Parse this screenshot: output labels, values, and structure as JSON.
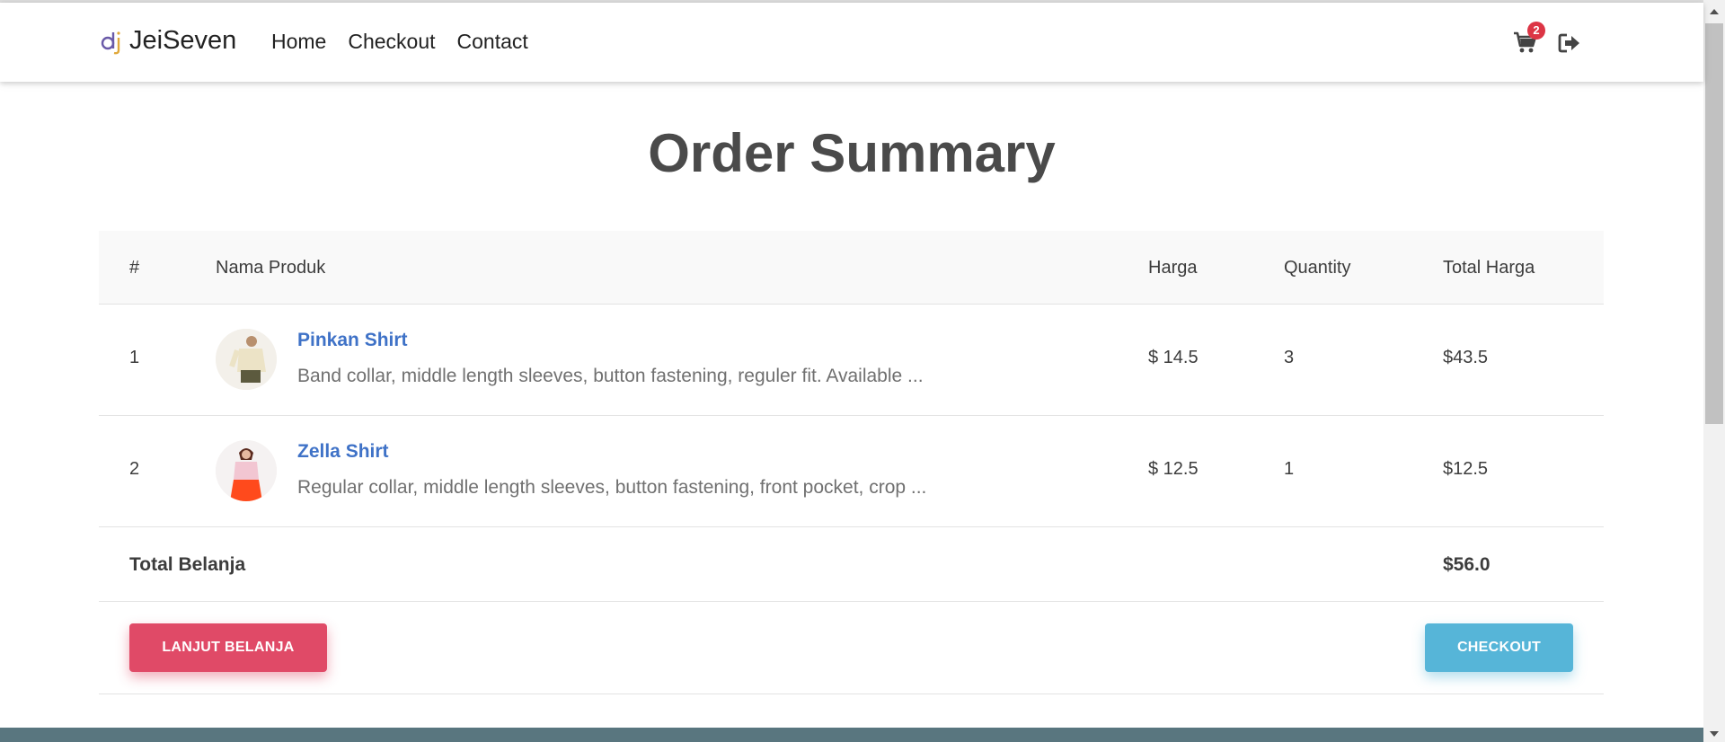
{
  "navbar": {
    "brand": "JeiSeven",
    "links": [
      "Home",
      "Checkout",
      "Contact"
    ],
    "cart_count": "2",
    "icons": [
      "cart-icon",
      "logout-icon"
    ]
  },
  "page": {
    "title": "Order Summary"
  },
  "table": {
    "headers": [
      "#",
      "Nama Produk",
      "Harga",
      "Quantity",
      "Total Harga"
    ],
    "rows": [
      {
        "num": "1",
        "name": "Pinkan Shirt",
        "desc": "Band collar, middle length sleeves, button fastening, reguler fit. Available ...",
        "price": "$ 14.5",
        "qty": "3",
        "total": "$43.5"
      },
      {
        "num": "2",
        "name": "Zella Shirt",
        "desc": "Regular collar, middle length sleeves, button fastening, front pocket, crop ...",
        "price": "$ 12.5",
        "qty": "1",
        "total": "$12.5"
      }
    ],
    "total_label": "Total Belanja",
    "total_value": "$56.0"
  },
  "buttons": {
    "lanjut": "LANJUT BELANJA",
    "checkout": "CHECKOUT"
  },
  "colors": {
    "danger": "#e04a67",
    "info": "#56b5d8",
    "link": "#3f72c7",
    "footer": "#59767f"
  }
}
